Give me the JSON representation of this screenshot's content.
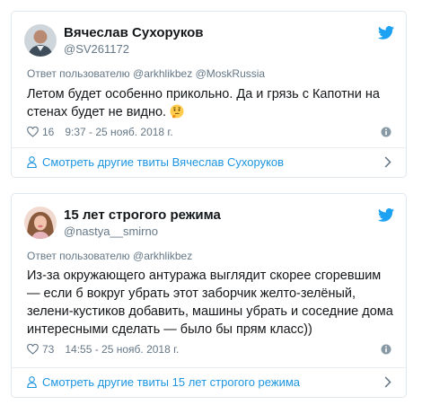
{
  "tweets": [
    {
      "name": "Вячеслав Сухоруков",
      "handle": "@SV261172",
      "reply_prefix": "Ответ пользователю",
      "reply_to_1": "@arkhlikbez",
      "reply_and": "@MoskRussia",
      "text": "Летом будет особенно прикольно. Да и грязь с Капотни на стенах будет не видно.",
      "emoji": "thinking-face-emoji",
      "likes": "16",
      "timestamp": "9:37 - 25 нояб. 2018 г.",
      "more_link": "Смотреть другие твиты Вячеслав Сухоруков"
    },
    {
      "name": "15 лет строгого режима",
      "handle": "@nastya__smirno",
      "reply_prefix": "Ответ пользователю",
      "reply_to_1": "@arkhlikbez",
      "text": "Из-за окружающего антуража выглядит скорее сгоревшим — если б вокруг убрать этот заборчик желто-зелёный, зелени-кустиков добавить, машины убрать и соседние дома интересными сделать — было бы прям класс))",
      "likes": "73",
      "timestamp": "14:55 - 25 нояб. 2018 г.",
      "more_link": "Смотреть другие твиты 15 лет строгого режима"
    }
  ],
  "colors": {
    "link": "#1b95e0",
    "muted": "#657786",
    "text": "#14171a",
    "border": "#e1e8ed",
    "twitter_blue": "#1da1f2"
  }
}
